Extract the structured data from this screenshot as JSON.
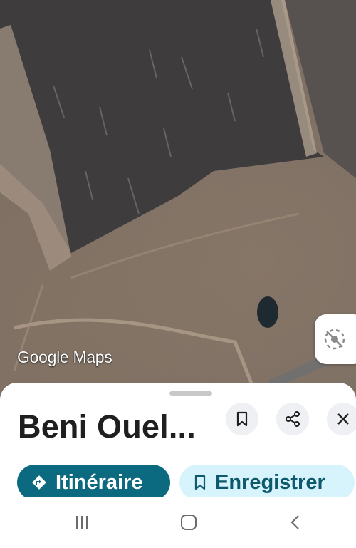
{
  "map": {
    "watermark": "Google Maps",
    "location_icon": "location-off-icon"
  },
  "place": {
    "title": "Beni Ouel..."
  },
  "header_actions": {
    "save_icon": "bookmark-icon",
    "share_icon": "share-icon",
    "close_icon": "close-icon"
  },
  "actions": {
    "directions_label": "Itinéraire",
    "directions_icon": "directions-icon",
    "save_label": "Enregistrer",
    "save_icon": "bookmark-icon"
  },
  "nav": {
    "recents_icon": "recent-apps-icon",
    "home_icon": "home-icon",
    "back_icon": "back-icon"
  },
  "colors": {
    "primary": "#0b6a7f",
    "primary_tonal": "#d7f3fb",
    "text": "#1f1f1f"
  }
}
